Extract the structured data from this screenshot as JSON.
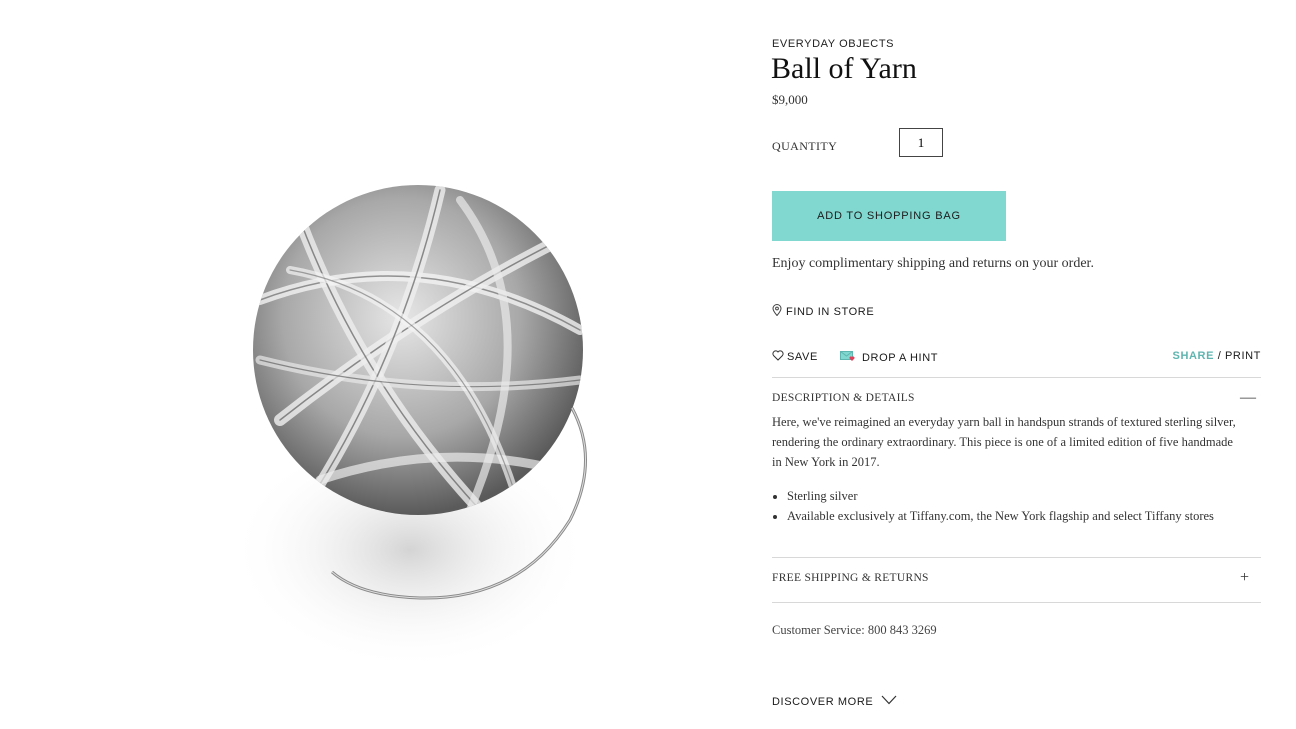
{
  "product": {
    "category": "EVERYDAY OBJECTS",
    "title": "Ball of Yarn",
    "price": "$9,000"
  },
  "quantity": {
    "label": "QUANTITY",
    "value": "1"
  },
  "add_to_bag": {
    "label": "ADD TO SHOPPING BAG",
    "color": "#81d8d0"
  },
  "shipping_note": "Enjoy complimentary shipping and returns on your order.",
  "find_in_store": {
    "label": "FIND IN STORE",
    "icon": "location-pin-icon"
  },
  "actions": {
    "save": {
      "label": "SAVE",
      "icon": "heart-icon"
    },
    "drop_hint": {
      "label": "DROP A HINT",
      "icon": "envelope-heart-icon"
    },
    "share": "SHARE",
    "separator": "/",
    "print": "PRINT",
    "share_color": "#5fb5b0"
  },
  "description": {
    "header": "DESCRIPTION & DETAILS",
    "toggle": "—",
    "text": "Here, we've reimagined an everyday yarn ball in handspun strands of textured sterling silver, rendering the ordinary extraordinary. This piece is one of a limited edition of five handmade in New York in 2017.",
    "bullets": [
      "Sterling silver",
      "Available exclusively at Tiffany.com, the New York flagship and select Tiffany stores"
    ]
  },
  "free_shipping": {
    "header": "FREE SHIPPING & RETURNS",
    "toggle": "+"
  },
  "customer_service": "Customer Service: 800 843 3269",
  "discover_more": {
    "label": "DISCOVER MORE",
    "icon": "chevron-down-icon"
  }
}
